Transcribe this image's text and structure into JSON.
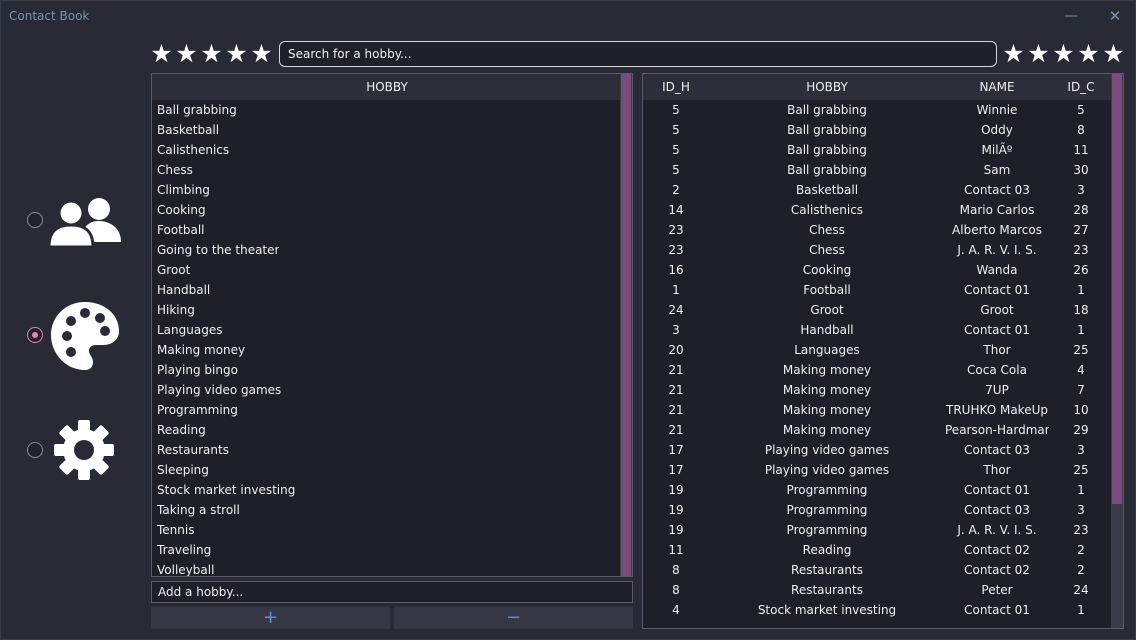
{
  "window": {
    "title": "Contact Book",
    "minimize_glyph": "—",
    "close_glyph": "✕"
  },
  "nav": [
    {
      "icon": "contacts-icon",
      "selected": false
    },
    {
      "icon": "palette-icon",
      "selected": true
    },
    {
      "icon": "gear-icon",
      "selected": false
    }
  ],
  "rating": {
    "left_stars": 5,
    "right_stars": 5,
    "star_glyph": "★"
  },
  "search": {
    "placeholder": "Search for a hobby..."
  },
  "hobby_table": {
    "header": "HOBBY",
    "items": [
      "Ball grabbing",
      "Basketball",
      "Calisthenics",
      "Chess",
      "Climbing",
      "Cooking",
      "Football",
      "Going to the theater",
      "Groot",
      "Handball",
      "Hiking",
      "Languages",
      "Making money",
      "Playing bingo",
      "Playing video games",
      "Programming",
      "Reading",
      "Restaurants",
      "Sleeping",
      "Stock market investing",
      "Taking a stroll",
      "Tennis",
      "Traveling",
      "Volleyball"
    ]
  },
  "add_hobby": {
    "placeholder": "Add a hobby...",
    "add_label": "+",
    "remove_label": "−"
  },
  "relation_table": {
    "headers": [
      "ID_H",
      "HOBBY",
      "NAME",
      "ID_C"
    ],
    "rows": [
      [
        "5",
        "Ball grabbing",
        "Winnie",
        "5"
      ],
      [
        "5",
        "Ball grabbing",
        "Oddy",
        "8"
      ],
      [
        "5",
        "Ball grabbing",
        "MilÃº",
        "11"
      ],
      [
        "5",
        "Ball grabbing",
        "Sam",
        "30"
      ],
      [
        "2",
        "Basketball",
        "Contact 03",
        "3"
      ],
      [
        "14",
        "Calisthenics",
        "Mario Carlos",
        "28"
      ],
      [
        "23",
        "Chess",
        "Alberto Marcos",
        "27"
      ],
      [
        "23",
        "Chess",
        "J. A. R. V. I. S.",
        "23"
      ],
      [
        "16",
        "Cooking",
        "Wanda",
        "26"
      ],
      [
        "1",
        "Football",
        "Contact 01",
        "1"
      ],
      [
        "24",
        "Groot",
        "Groot",
        "18"
      ],
      [
        "3",
        "Handball",
        "Contact 01",
        "1"
      ],
      [
        "20",
        "Languages",
        "Thor",
        "25"
      ],
      [
        "21",
        "Making money",
        "Coca Cola",
        "4"
      ],
      [
        "21",
        "Making money",
        "7UP",
        "7"
      ],
      [
        "21",
        "Making money",
        "TRUHKO MakeUp",
        "10"
      ],
      [
        "21",
        "Making money",
        "Pearson-Hardman",
        "29"
      ],
      [
        "17",
        "Playing video games",
        "Contact 03",
        "3"
      ],
      [
        "17",
        "Playing video games",
        "Thor",
        "25"
      ],
      [
        "19",
        "Programming",
        "Contact 01",
        "1"
      ],
      [
        "19",
        "Programming",
        "Contact 03",
        "3"
      ],
      [
        "19",
        "Programming",
        "J. A. R. V. I. S.",
        "23"
      ],
      [
        "11",
        "Reading",
        "Contact 02",
        "2"
      ],
      [
        "8",
        "Restaurants",
        "Contact 02",
        "2"
      ],
      [
        "8",
        "Restaurants",
        "Peter",
        "24"
      ],
      [
        "4",
        "Stock market investing",
        "Contact 01",
        "1"
      ]
    ]
  },
  "colors": {
    "background": "#282a35",
    "panel": "#1e1f29",
    "header": "#2d2e3a",
    "scroll_thumb": "#7b4c7b",
    "accent_radio": "#e884b8",
    "title_text": "#7f8fb8",
    "button_glyph": "#5b8fd8"
  }
}
